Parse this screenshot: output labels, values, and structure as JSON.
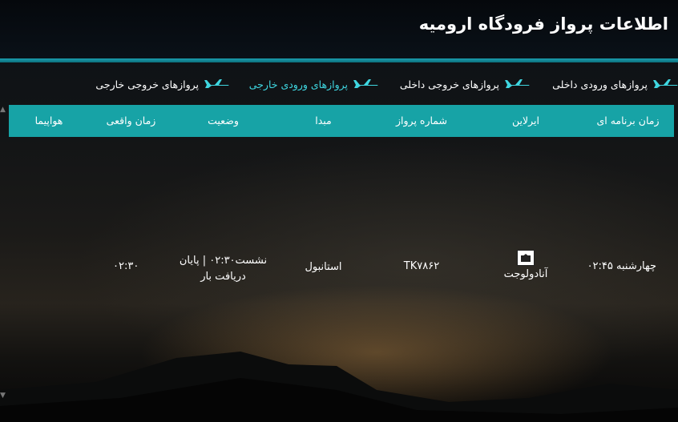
{
  "header": {
    "title": "اطلاعات پرواز فرودگاه ارومیه"
  },
  "tabs": [
    {
      "label": "پروازهای ورودی داخلی",
      "icon": "plane-icon",
      "active": false
    },
    {
      "label": "پروازهای خروجی داخلی",
      "icon": "plane-icon",
      "active": false
    },
    {
      "label": "پروازهای ورودی خارجی",
      "icon": "plane-icon",
      "active": true
    },
    {
      "label": "پروازهای خروجی خارجی",
      "icon": "plane-icon",
      "active": false
    }
  ],
  "table": {
    "columns": [
      "زمان برنامه ای",
      "ایرلاین",
      "شماره پرواز",
      "مبدا",
      "وضعیت",
      "زمان واقعی",
      "هواپیما"
    ],
    "rows": [
      {
        "scheduled": "چهارشنبه ۰۲:۴۵",
        "airline": "آنادولوجت",
        "flight_no": "TK۷۸۶۲",
        "origin": "استانبول",
        "status_line1": "نشست۰۲:۳۰ | پایان",
        "status_line2": "دریافت بار",
        "actual": "۰۲:۳۰",
        "aircraft": ""
      }
    ]
  },
  "colors": {
    "accent": "#17a3a6",
    "active_tab": "#3fd6e0",
    "header_line": "#1a9fb0"
  }
}
